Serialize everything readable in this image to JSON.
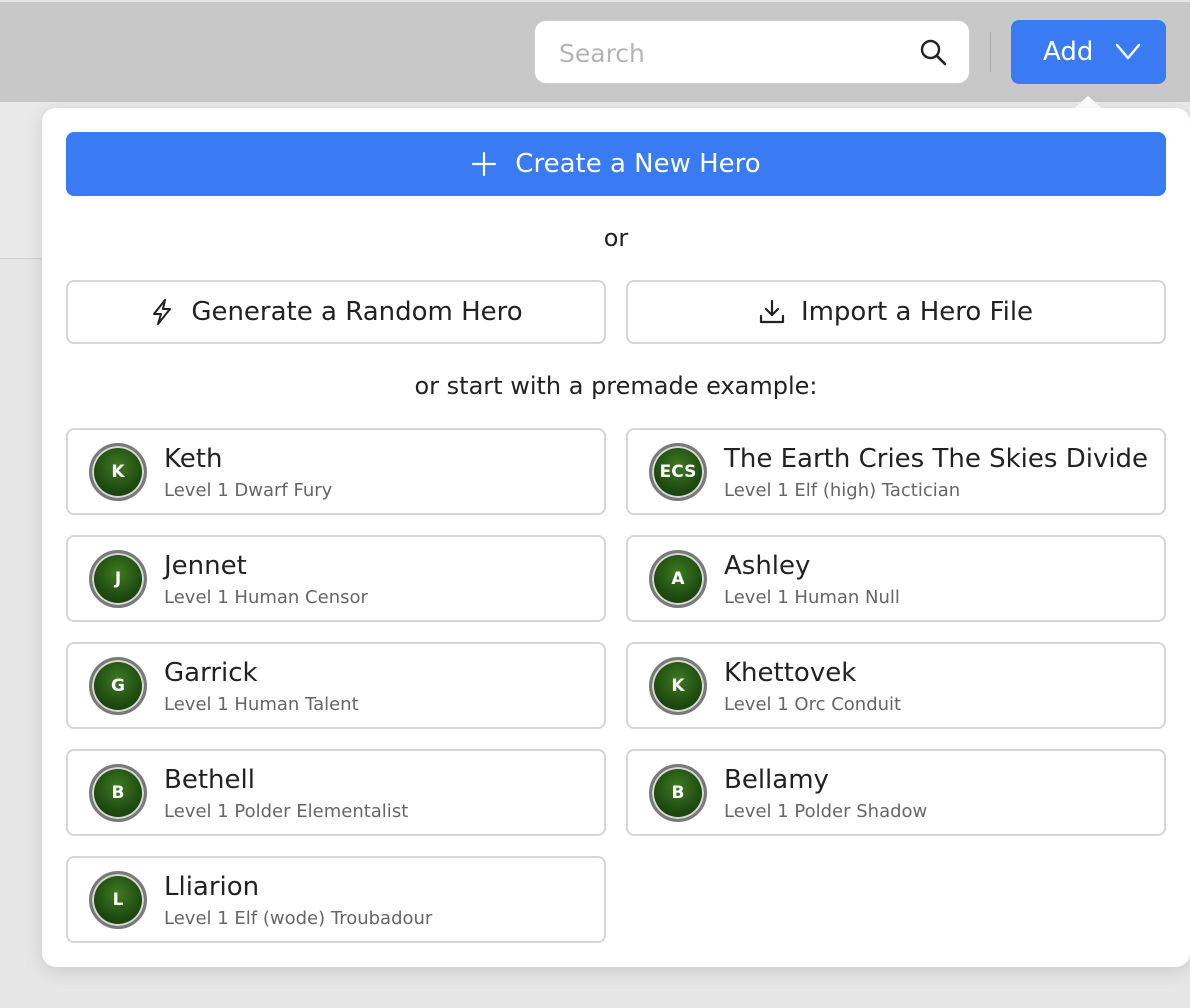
{
  "header": {
    "search_placeholder": "Search",
    "add_label": "Add",
    "icons": {
      "search": "search-icon",
      "add_chevron": "chevron-down-icon"
    }
  },
  "menu": {
    "create_label": "Create a New Hero",
    "or_label": "or",
    "generate_label": "Generate a Random Hero",
    "import_label": "Import a Hero File",
    "premade_label": "or start with a premade example:",
    "icons": {
      "create": "plus-icon",
      "generate": "lightning-icon",
      "import": "download-icon"
    }
  },
  "premades": [
    {
      "initials": "K",
      "name": "Keth",
      "desc": "Level 1 Dwarf Fury"
    },
    {
      "initials": "ECS",
      "name": "The Earth Cries The Skies Divide",
      "desc": "Level 1 Elf (high) Tactician"
    },
    {
      "initials": "J",
      "name": "Jennet",
      "desc": "Level 1 Human Censor"
    },
    {
      "initials": "A",
      "name": "Ashley",
      "desc": "Level 1 Human Null"
    },
    {
      "initials": "G",
      "name": "Garrick",
      "desc": "Level 1 Human Talent"
    },
    {
      "initials": "K",
      "name": "Khettovek",
      "desc": "Level 1 Orc Conduit"
    },
    {
      "initials": "B",
      "name": "Bethell",
      "desc": "Level 1 Polder Elementalist"
    },
    {
      "initials": "B",
      "name": "Bellamy",
      "desc": "Level 1 Polder Shadow"
    },
    {
      "initials": "L",
      "name": "Lliarion",
      "desc": "Level 1 Elf (wode) Troubadour"
    }
  ],
  "colors": {
    "primary": "#3a7af2",
    "avatar": "#1d4a10"
  }
}
